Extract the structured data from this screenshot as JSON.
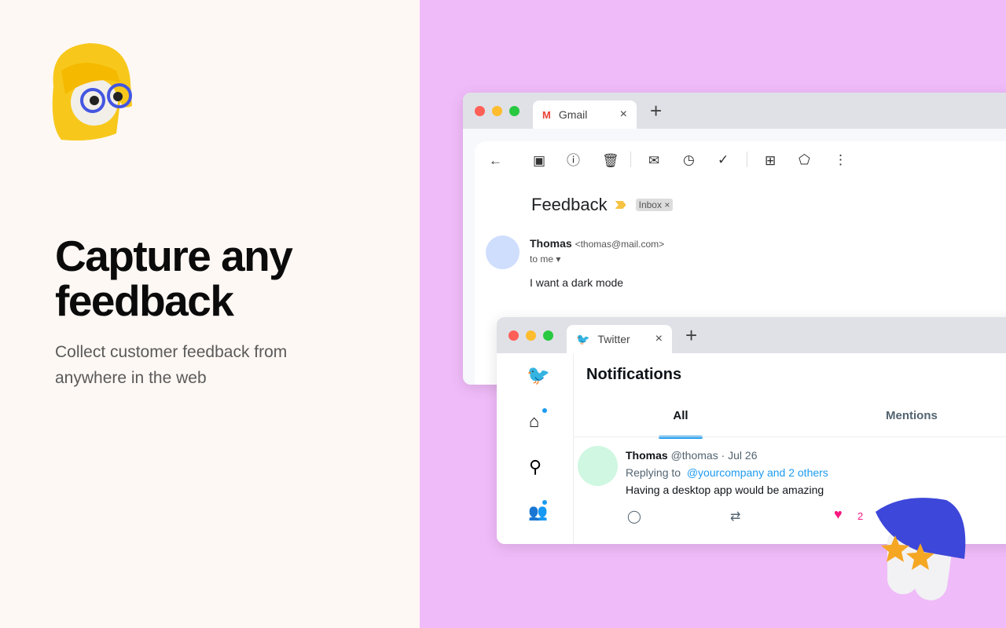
{
  "hero": {
    "title_line1": "Capture any",
    "title_line2": "feedback",
    "subtitle": "Collect customer feedback from anywhere in the web"
  },
  "gmail": {
    "tab_label": "Gmail",
    "toolbar_icons": [
      "back-arrow-icon",
      "archive-icon",
      "report-spam-icon",
      "trash-icon",
      "mark-unread-icon",
      "snooze-icon",
      "add-task-icon",
      "move-to-icon",
      "label-icon",
      "more-vert-icon"
    ],
    "subject": "Feedback",
    "label_chip": "Inbox",
    "sender_name": "Thomas",
    "sender_email": "<thomas@mail.com>",
    "recipient": "to me",
    "body": "I want a dark mode"
  },
  "twitter": {
    "tab_label": "Twitter",
    "page_title": "Notifications",
    "tabs": [
      {
        "label": "All",
        "active": true
      },
      {
        "label": "Mentions",
        "active": false
      }
    ],
    "tweet": {
      "name": "Thomas",
      "handle": "@thomas",
      "date": "· Jul 26",
      "replying_prefix": "Replying to",
      "replying_to": "@yourcompany and 2 others",
      "text": "Having a desktop app would be amazing",
      "likes": "2"
    },
    "accent": "#1d9bf0",
    "like_color": "#f91880"
  },
  "colors": {
    "left_bg": "#fef8f4",
    "right_bg": "#f0bbf9"
  }
}
